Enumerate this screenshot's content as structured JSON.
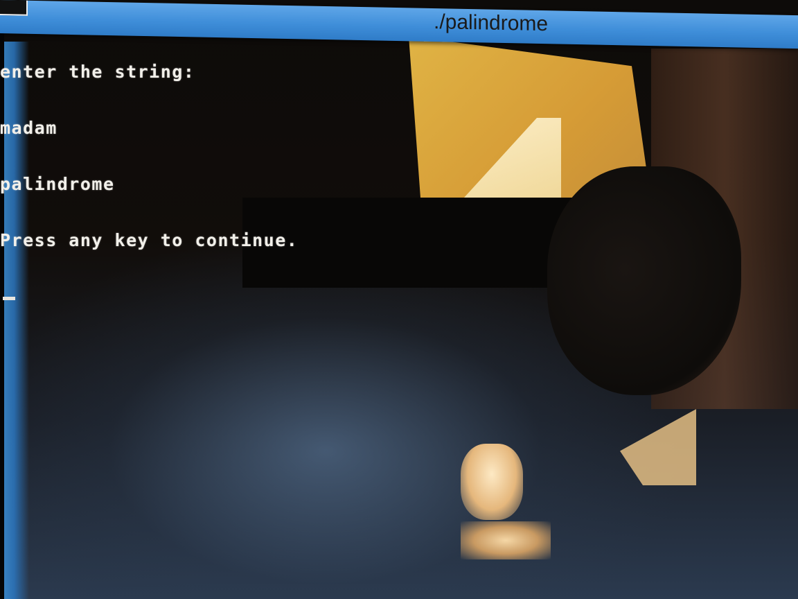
{
  "window": {
    "title": "./palindrome"
  },
  "console": {
    "lines": [
      "enter the string:",
      "madam",
      "palindrome",
      "Press any key to continue."
    ]
  },
  "colors": {
    "titlebar": "#3f8ed9",
    "console_text": "#f2f0ea",
    "console_bg": "#0d0b09"
  }
}
